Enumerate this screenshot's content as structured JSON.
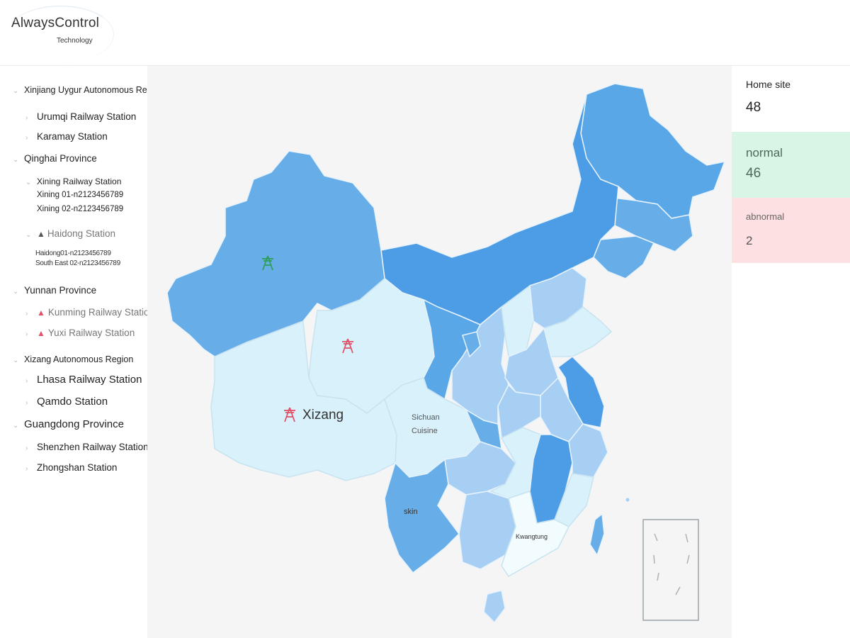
{
  "brand": {
    "name": "AlwaysControl",
    "tagline": "Technology"
  },
  "tree": [
    {
      "label": "Xinjiang Uygur Autonomous Region",
      "children": [
        {
          "label": "Urumqi Railway Station"
        },
        {
          "label": "Karamay Station"
        }
      ]
    },
    {
      "label": "Qinghai Province",
      "children": [
        {
          "label": "Xining Railway Station",
          "devices": [
            "Xining 01-n2123456789",
            "Xining 02-n2123456789"
          ]
        },
        {
          "label": "Haidong Station",
          "devices": [
            "Haidong01-n2123456789",
            "South East 02-n2123456789"
          ]
        }
      ]
    },
    {
      "label": "Yunnan Province",
      "children": [
        {
          "label": "Kunming Railway Station"
        },
        {
          "label": "Yuxi Railway Station"
        }
      ]
    },
    {
      "label": "Xizang Autonomous Region",
      "children": [
        {
          "label": "Lhasa Railway Station"
        },
        {
          "label": "Qamdo Station"
        }
      ]
    },
    {
      "label": "Guangdong Province",
      "children": [
        {
          "label": "Shenzhen Railway Station"
        },
        {
          "label": "Zhongshan Station"
        }
      ]
    }
  ],
  "map": {
    "labels": {
      "xizang": "Xizang",
      "sichuan": "Sichuan\nCuisine",
      "yunnan": "skin",
      "guangdong": "Kwangtung"
    },
    "colors": {
      "dark": "#4d9de6",
      "mid": "#67aee9",
      "light": "#a6cff3",
      "pale": "#d8f1fb",
      "marker_green": "#2e9e5b",
      "marker_red": "#e0546a"
    }
  },
  "stats": {
    "home": {
      "label": "Home site",
      "value": "48"
    },
    "normal": {
      "label": "normal",
      "value": "46"
    },
    "abnormal": {
      "label": "abnormal",
      "value": "2"
    }
  }
}
